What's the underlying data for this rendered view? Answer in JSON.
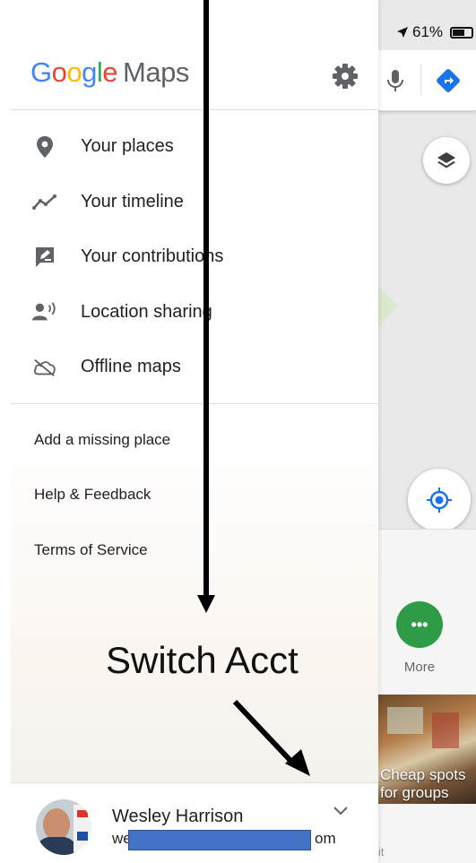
{
  "status_bar": {
    "battery": "61%",
    "location_icon": "location-arrow-icon",
    "battery_icon": "battery-icon"
  },
  "drawer": {
    "logo": {
      "google_letters": [
        "G",
        "o",
        "o",
        "g",
        "l",
        "e"
      ],
      "maps": "Maps"
    },
    "settings_icon": "gear-icon",
    "main_menu": [
      {
        "label": "Your places",
        "icon": "place-pin-icon"
      },
      {
        "label": "Your timeline",
        "icon": "timeline-icon"
      },
      {
        "label": "Your contributions",
        "icon": "contributions-icon"
      },
      {
        "label": "Location sharing",
        "icon": "location-sharing-icon"
      },
      {
        "label": "Offline maps",
        "icon": "offline-cloud-icon"
      }
    ],
    "secondary_menu": [
      {
        "label": "Add a missing place"
      },
      {
        "label": "Help & Feedback"
      },
      {
        "label": "Terms of Service"
      }
    ],
    "account": {
      "name": "Wesley Harrison",
      "email_prefix": "we",
      "email_suffix": "om",
      "chevron_icon": "chevron-down-icon"
    }
  },
  "annotation": {
    "label": "Switch Acct"
  },
  "map_panel": {
    "more_label": "More",
    "more_glyph": "•••",
    "photo_caption_line1": "Cheap spots",
    "photo_caption_line2": "for groups",
    "bottom_text": "it"
  },
  "colors": {
    "google_blue": "#4285f4",
    "google_red": "#ea4335",
    "google_yellow": "#fbbc05",
    "google_green": "#34a853",
    "more_green": "#2e9b46",
    "redaction_blue": "#4472c4",
    "icon_gray": "#5f6368"
  }
}
